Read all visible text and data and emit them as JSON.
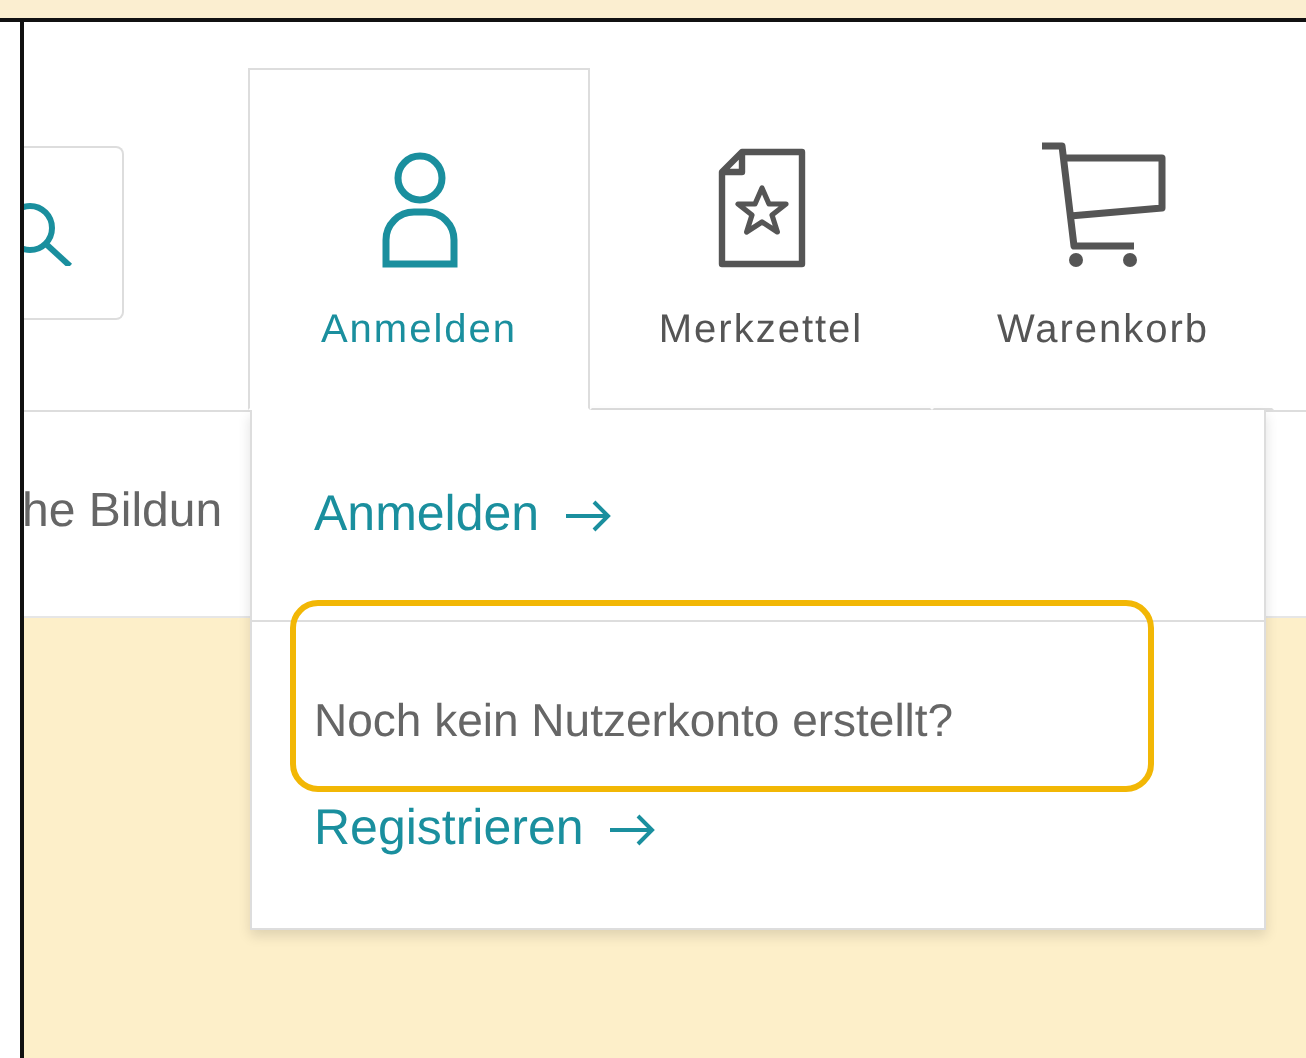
{
  "tabs": [
    {
      "kind": "person",
      "label": "Anmelden",
      "selected": true
    },
    {
      "kind": "wishlist",
      "label": "Merkzettel",
      "selected": false
    },
    {
      "kind": "cart",
      "label": "Warenkorb",
      "selected": false
    }
  ],
  "nav": {
    "text": "he Bildun"
  },
  "dropdown": {
    "login_link": "Anmelden",
    "question": "Noch kein Nutzerkonto erstellt?",
    "question_highlighted": true,
    "register_link": "Registrieren"
  }
}
